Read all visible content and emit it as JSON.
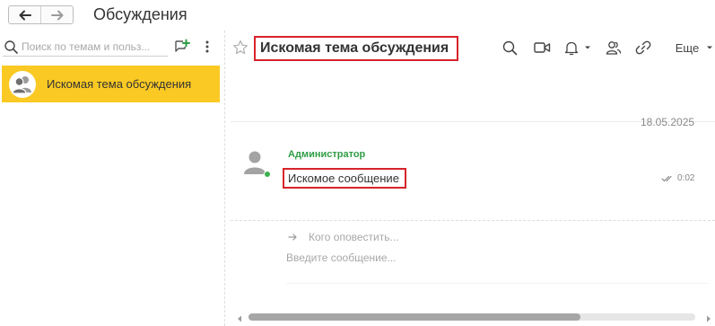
{
  "window": {
    "title": "Обсуждения"
  },
  "nav": {
    "back_icon": "arrow-left-icon",
    "forward_icon": "arrow-right-icon"
  },
  "sidebar": {
    "search": {
      "placeholder": "Поиск по темам и польз...",
      "value": ""
    },
    "add_icon": "add-conversation-icon",
    "more_icon": "vertical-dots-icon",
    "topics": [
      {
        "label": "Искомая тема обсуждения",
        "selected": true,
        "icon": "group-avatar-icon"
      }
    ]
  },
  "thread": {
    "title": "Искомая тема обсуждения",
    "star_icon": "star-icon",
    "toolbar": {
      "search_icon": "search-icon",
      "video_icon": "video-camera-icon",
      "notify_icon": "bell-icon",
      "members_icon": "participants-icon",
      "link_icon": "link-icon",
      "more_label": "Еще"
    },
    "date_separator": "18.05.2025",
    "messages": [
      {
        "author": "Администратор",
        "text": "Искомое сообщение",
        "time": "0:02",
        "status_icon": "double-check-icon",
        "online": true
      }
    ],
    "composer": {
      "recipients_placeholder": "Кого оповестить...",
      "message_placeholder": "Введите сообщение..."
    },
    "scrollbar": {
      "position": 0.74
    }
  },
  "colors": {
    "selection": "#fac923",
    "highlight_border": "#d8232a",
    "author": "#2f9d45",
    "online": "#3cb04b"
  }
}
